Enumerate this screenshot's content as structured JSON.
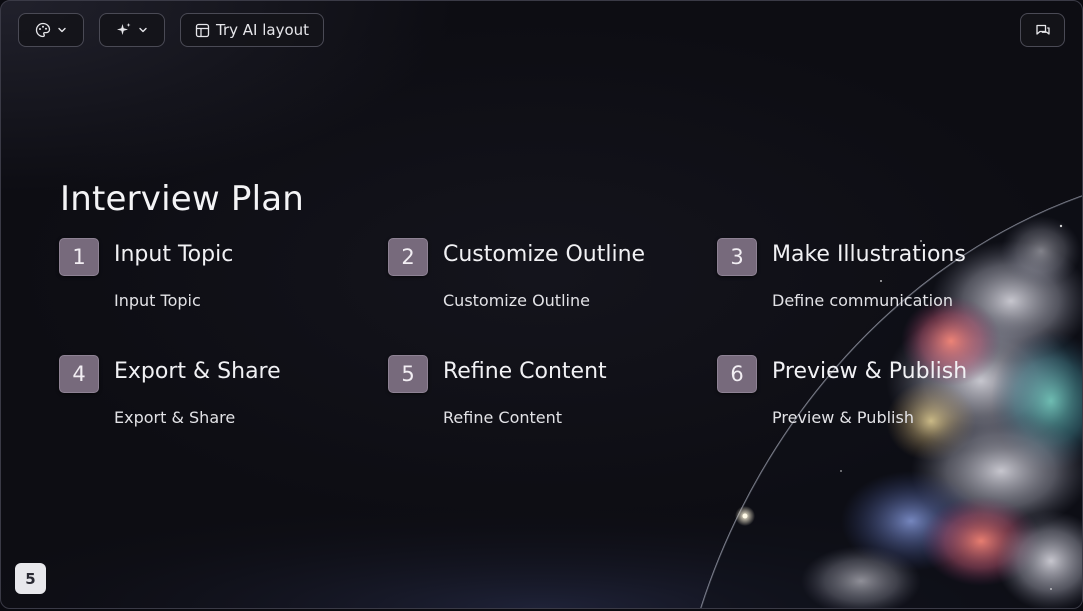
{
  "toolbar": {
    "theme_icon": "palette-icon",
    "ai_icon": "sparkle-icon",
    "layout_icon": "layout-icon",
    "layout_label": "Try AI layout",
    "chat_icon": "chat-icon"
  },
  "slide": {
    "title": "Interview Plan",
    "steps": [
      {
        "num": "1",
        "title": "Input Topic",
        "desc": "Input Topic"
      },
      {
        "num": "2",
        "title": "Customize Outline",
        "desc": "Customize Outline"
      },
      {
        "num": "3",
        "title": "Make Illustrations",
        "desc": "Define communication"
      },
      {
        "num": "4",
        "title": "Export & Share",
        "desc": "Export & Share"
      },
      {
        "num": "5",
        "title": "Refine Content",
        "desc": "Refine Content"
      },
      {
        "num": "6",
        "title": "Preview & Publish",
        "desc": "Preview & Publish"
      }
    ],
    "page_number": "5"
  },
  "colors": {
    "background": "#0c0c12",
    "badge": "#776a7c",
    "text": "#f1f1f4"
  }
}
